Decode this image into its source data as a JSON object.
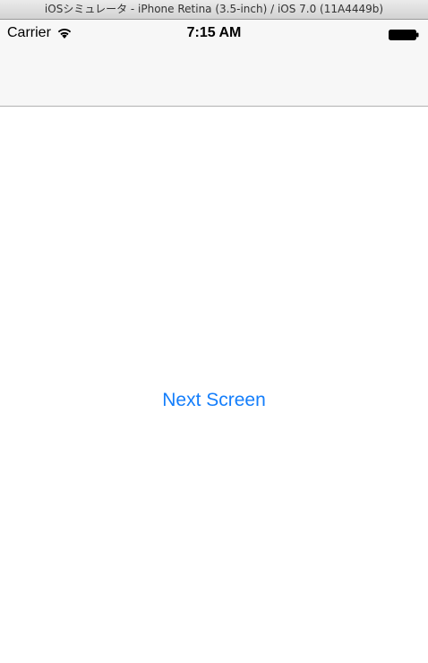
{
  "window": {
    "title": "iOSシミュレータ - iPhone Retina (3.5-inch) / iOS 7.0 (11A4449b)"
  },
  "status_bar": {
    "carrier": "Carrier",
    "time": "7:15 AM",
    "icons": [
      "wifi-icon",
      "battery-icon"
    ]
  },
  "content": {
    "next_button_label": "Next Screen"
  },
  "colors": {
    "tint": "#147efb",
    "nav_background": "#f7f7f7",
    "background": "#ffffff"
  }
}
